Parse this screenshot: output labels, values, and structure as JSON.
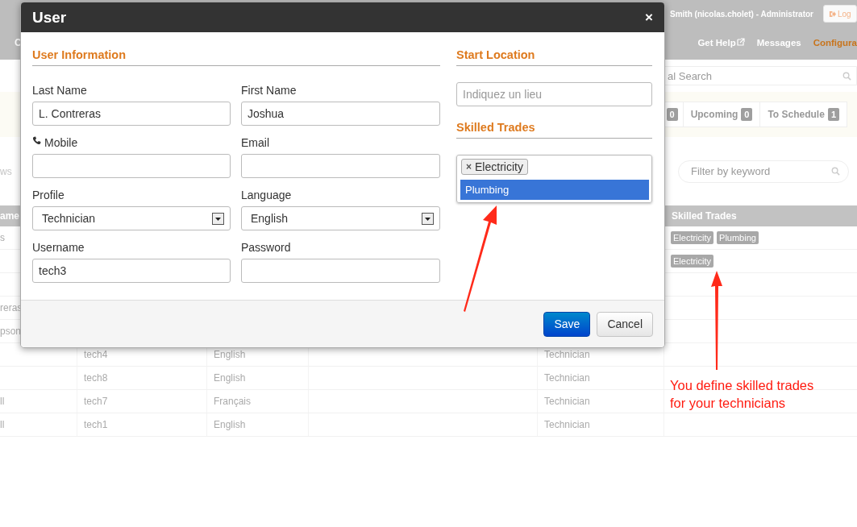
{
  "header": {
    "user": "Smith (nicolas.cholet) - Administrator",
    "logout": "Log",
    "nav_left": "C",
    "nav": [
      {
        "label": "Get Help",
        "external": true,
        "selected": false
      },
      {
        "label": "Messages",
        "external": false,
        "selected": false
      },
      {
        "label": "Configura",
        "external": false,
        "selected": true
      }
    ]
  },
  "search": {
    "placeholder": "al Search"
  },
  "tabs": [
    {
      "count": "0"
    },
    {
      "label": "Upcoming",
      "count": "0"
    },
    {
      "label": "To Schedule",
      "count": "1"
    }
  ],
  "views_label": "ws",
  "filter": {
    "placeholder": "Filter by keyword"
  },
  "table": {
    "columns": {
      "column_1": "ame",
      "skilled_trades": "Skilled Trades"
    },
    "rows": [
      {
        "name": "s",
        "trades": [
          "Electricity",
          "Plumbing"
        ]
      },
      {
        "trades": [
          "Electricity"
        ]
      },
      {},
      {
        "name": "reras"
      },
      {
        "name": "pson"
      },
      {
        "username": "tech4",
        "language": "English",
        "profile": "Technician"
      },
      {
        "username": "tech8",
        "language": "English",
        "profile": "Technician"
      },
      {
        "name": "ll",
        "username": "tech7",
        "language": "Français",
        "profile": "Technician"
      },
      {
        "name": "ll",
        "username": "tech1",
        "language": "English",
        "profile": "Technician"
      }
    ]
  },
  "dialog": {
    "title": "User",
    "close": "×",
    "user_info": {
      "heading": "User Information",
      "fields": [
        {
          "kind": "text",
          "label": "Last Name",
          "value": "L. Contreras"
        },
        {
          "kind": "text",
          "label": "First Name",
          "value": "Joshua"
        },
        {
          "kind": "phone",
          "label": "Mobile"
        },
        {
          "kind": "text",
          "label": "Email"
        },
        {
          "kind": "select",
          "label": "Profile",
          "value": "Technician"
        },
        {
          "kind": "select",
          "label": "Language",
          "value": "English"
        },
        {
          "kind": "text",
          "label": "Username",
          "value": "tech3"
        },
        {
          "kind": "password",
          "label": "Password"
        }
      ]
    },
    "start_location": {
      "heading": "Start Location",
      "placeholder": "Indiquez un lieu"
    },
    "skilled_trades": {
      "heading": "Skilled Trades",
      "tags": [
        {
          "label": "Electricity",
          "remove": "×"
        }
      ],
      "options": [
        {
          "label": "Plumbing",
          "selected": true
        }
      ]
    },
    "buttons": [
      {
        "label": "Save",
        "kind": "primary"
      },
      {
        "label": "Cancel",
        "kind": "default"
      }
    ]
  },
  "annotation": {
    "text": "You define skilled trades for your technicians"
  }
}
